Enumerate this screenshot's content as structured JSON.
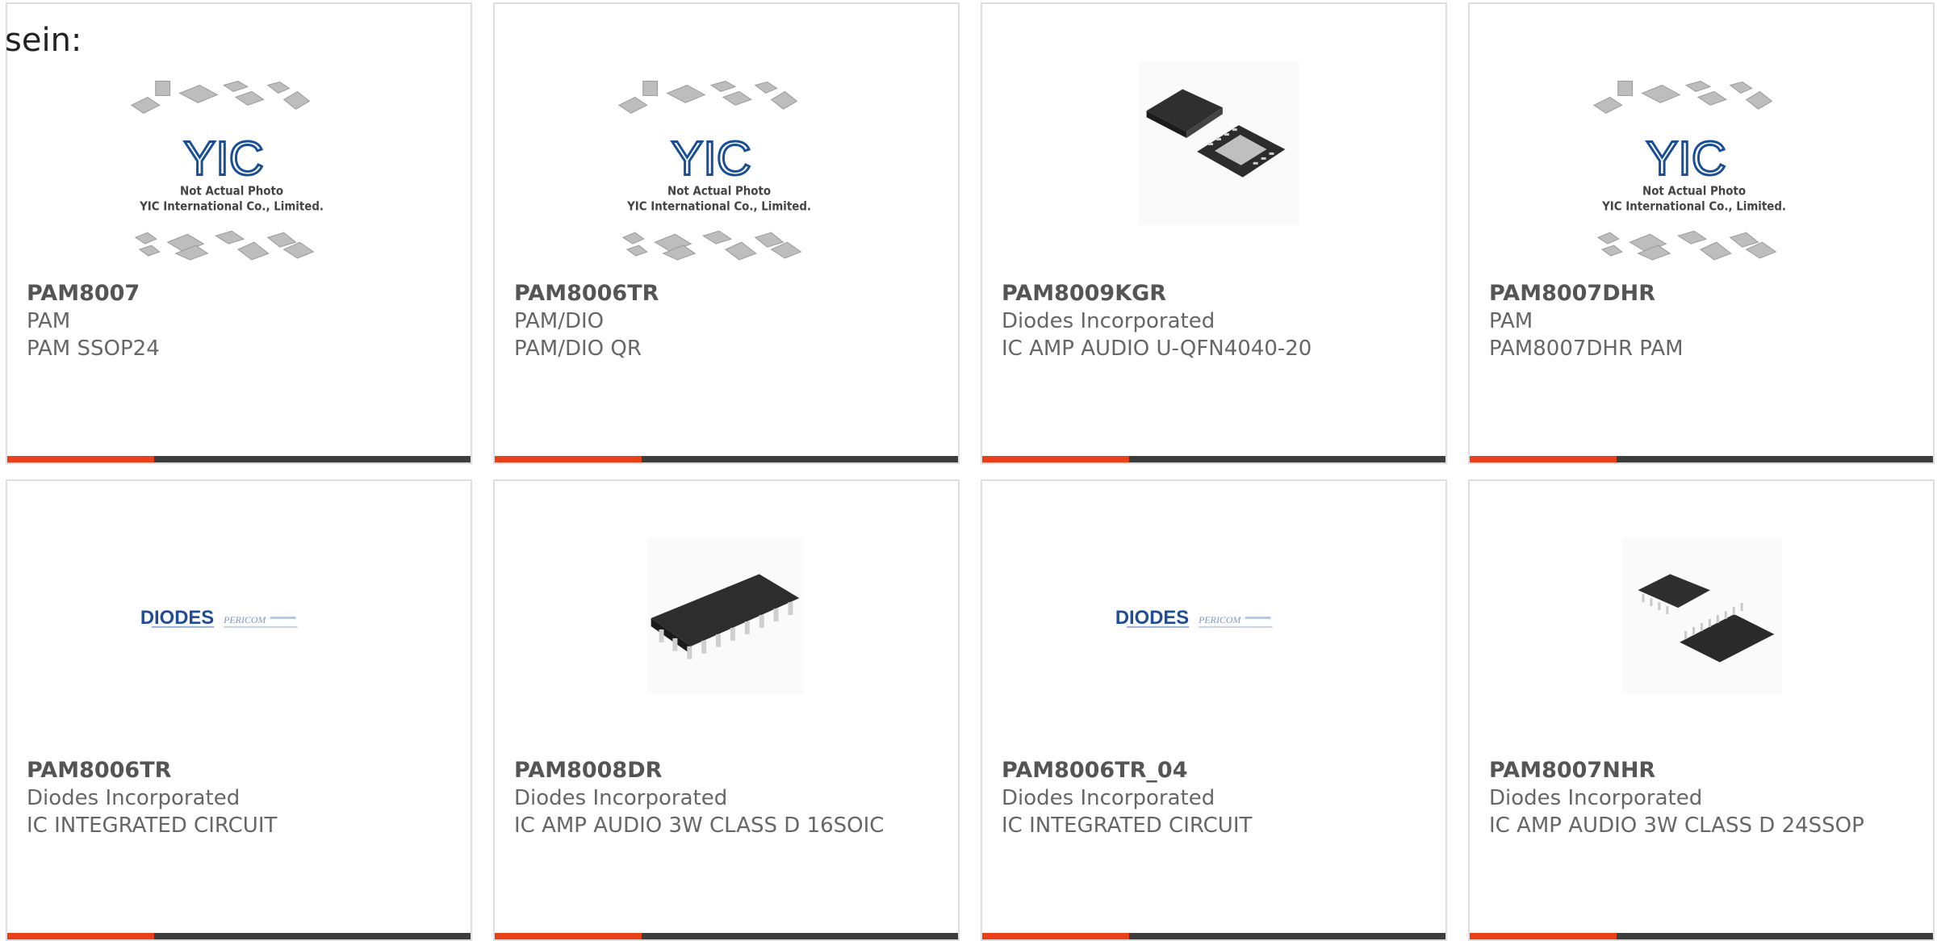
{
  "lead_text": "sein:",
  "colors": {
    "accent": "#e8411a",
    "bar_dark": "#3d3d3d",
    "border": "#dedede",
    "text": "#666666"
  },
  "cards": [
    {
      "part_number": "PAM8007",
      "manufacturer": "PAM",
      "description": "PAM SSOP24",
      "image": "placeholder",
      "placeholder": {
        "logo": "YIC",
        "line1": "Not Actual Photo",
        "line2": "YIC International Co., Limited."
      }
    },
    {
      "part_number": "PAM8006TR",
      "manufacturer": "PAM/DIO",
      "description": "PAM/DIO QR",
      "image": "placeholder",
      "placeholder": {
        "logo": "YIC",
        "line1": "Not Actual Photo",
        "line2": "YIC International Co., Limited."
      }
    },
    {
      "part_number": "PAM8009KGR",
      "manufacturer": "Diodes Incorporated",
      "description": "IC AMP AUDIO U-QFN4040-20",
      "image": "qfn-chip"
    },
    {
      "part_number": "PAM8007DHR",
      "manufacturer": "PAM",
      "description": "PAM8007DHR PAM",
      "image": "placeholder",
      "placeholder": {
        "logo": "YIC",
        "line1": "Not Actual Photo",
        "line2": "YIC International Co., Limited."
      }
    },
    {
      "part_number": "PAM8006TR",
      "manufacturer": "Diodes Incorporated",
      "description": "IC INTEGRATED CIRCUIT",
      "image": "diodes-logo",
      "logo": {
        "brand": "DIODES",
        "sub": "PERICOM"
      }
    },
    {
      "part_number": "PAM8008DR",
      "manufacturer": "Diodes Incorporated",
      "description": "IC AMP AUDIO 3W CLASS D 16SOIC",
      "image": "soic-chip"
    },
    {
      "part_number": "PAM8006TR_04",
      "manufacturer": "Diodes Incorporated",
      "description": "IC INTEGRATED CIRCUIT",
      "image": "diodes-logo",
      "logo": {
        "brand": "DIODES",
        "sub": "PERICOM"
      }
    },
    {
      "part_number": "PAM8007NHR",
      "manufacturer": "Diodes Incorporated",
      "description": "IC AMP AUDIO 3W CLASS D 24SSOP",
      "image": "ssop-chip"
    }
  ]
}
